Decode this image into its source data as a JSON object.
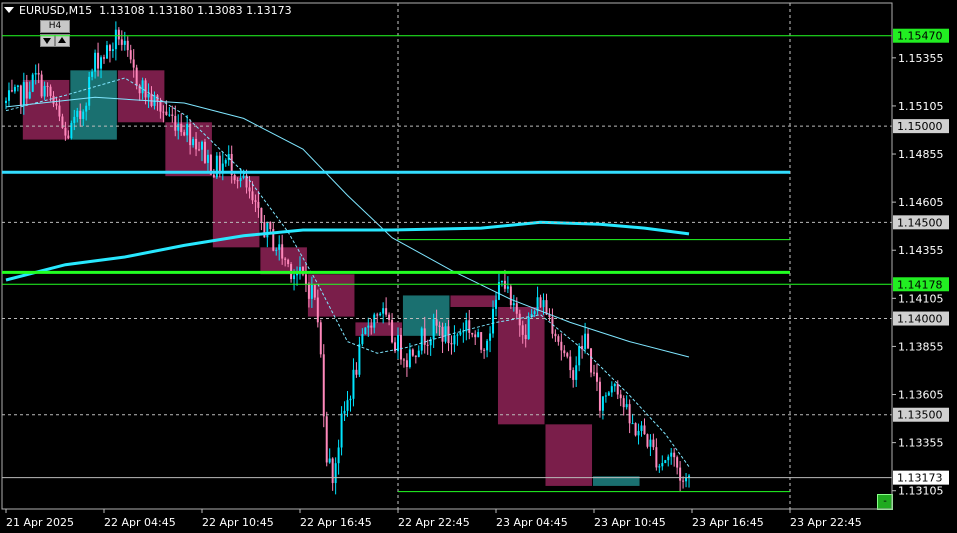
{
  "header": {
    "symbol": "EURUSD,M15",
    "ohlc": "1.13108 1.13180 1.13083 1.13173"
  },
  "timeframe_box": {
    "label": "H4"
  },
  "minus_button": {
    "label": "-"
  },
  "colors": {
    "background": "#000000",
    "bull_candle": "#00e5ff",
    "bear_candle": "#ff88bb",
    "h4_bull_box": "#1a7070",
    "h4_bear_box": "#7a1e4a",
    "ma_fast": "#7fe6ff",
    "ma_slow": "#28e8ff",
    "level_green": "#22ff22",
    "level_cyan": "#33ddff",
    "price_tag": "#d0d0d0",
    "green_tag": "#22ee22"
  },
  "chart_data": {
    "type": "candlestick",
    "symbol": "EURUSD",
    "timeframe": "M15",
    "ylim": [
      1.1301,
      1.1564
    ],
    "y_ticks": [
      1.15355,
      1.15105,
      1.14855,
      1.14605,
      1.14355,
      1.14105,
      1.13855,
      1.13605,
      1.13355,
      1.13105
    ],
    "x_ticks": [
      {
        "label": "21 Apr 2025",
        "i": 0
      },
      {
        "label": "22 Apr 04:45",
        "i": 33
      },
      {
        "label": "22 Apr 10:45",
        "i": 66
      },
      {
        "label": "22 Apr 16:45",
        "i": 99
      },
      {
        "label": "22 Apr 22:45",
        "i": 132
      },
      {
        "label": "23 Apr 04:45",
        "i": 165
      },
      {
        "label": "23 Apr 10:45",
        "i": 198
      },
      {
        "label": "23 Apr 16:45",
        "i": 231
      },
      {
        "label": "23 Apr 22:45",
        "i": 264
      }
    ],
    "vertical_dashed_at": [
      132,
      264
    ],
    "levels": [
      {
        "price": 1.1547,
        "color": "green",
        "style": "thin",
        "tag": "1.15470",
        "tag_style": "green"
      },
      {
        "price": 1.15,
        "color": "gray",
        "style": "dashed",
        "tag": "1.15000",
        "tag_style": "gray"
      },
      {
        "price": 1.1476,
        "color": "cyan",
        "style": "thick",
        "tag": "",
        "tag_style": ""
      },
      {
        "price": 1.145,
        "color": "gray",
        "style": "dashed",
        "tag": "1.14500",
        "tag_style": "gray"
      },
      {
        "price": 1.1441,
        "color": "green",
        "style": "thin_partial",
        "tag": "",
        "tag_style": ""
      },
      {
        "price": 1.1424,
        "color": "green",
        "style": "thick",
        "tag": "",
        "tag_style": ""
      },
      {
        "price": 1.14178,
        "color": "green",
        "style": "thin",
        "tag": "1.14178",
        "tag_style": "green"
      },
      {
        "price": 1.14,
        "color": "gray",
        "style": "dashed",
        "tag": "1.14000",
        "tag_style": "gray"
      },
      {
        "price": 1.135,
        "color": "gray",
        "style": "dashed",
        "tag": "1.13500",
        "tag_style": "gray"
      },
      {
        "price": 1.13173,
        "color": "gray",
        "style": "thin",
        "tag": "1.13173",
        "tag_style": "white"
      },
      {
        "price": 1.131,
        "color": "green",
        "style": "thin_partial",
        "tag": "",
        "tag_style": ""
      }
    ],
    "h4_boxes": [
      {
        "start": 6,
        "end": 21,
        "open": 1.1524,
        "close": 1.1493,
        "bull": false
      },
      {
        "start": 22,
        "end": 37,
        "open": 1.1493,
        "close": 1.1529,
        "bull": true
      },
      {
        "start": 38,
        "end": 53,
        "open": 1.1529,
        "close": 1.1502,
        "bull": false
      },
      {
        "start": 54,
        "end": 69,
        "open": 1.1502,
        "close": 1.1474,
        "bull": false
      },
      {
        "start": 70,
        "end": 85,
        "open": 1.1474,
        "close": 1.1437,
        "bull": false
      },
      {
        "start": 86,
        "end": 101,
        "open": 1.1437,
        "close": 1.1423,
        "bull": false
      },
      {
        "start": 102,
        "end": 117,
        "open": 1.1423,
        "close": 1.1401,
        "bull": false
      },
      {
        "start": 118,
        "end": 133,
        "open": 1.1398,
        "close": 1.1391,
        "bull": false
      },
      {
        "start": 134,
        "end": 149,
        "open": 1.1391,
        "close": 1.1412,
        "bull": true
      },
      {
        "start": 150,
        "end": 165,
        "open": 1.1412,
        "close": 1.1406,
        "bull": false
      },
      {
        "start": 166,
        "end": 181,
        "open": 1.1406,
        "close": 1.1345,
        "bull": false
      },
      {
        "start": 182,
        "end": 197,
        "open": 1.1345,
        "close": 1.1313,
        "bull": false
      },
      {
        "start": 198,
        "end": 213,
        "open": 1.1313,
        "close": 1.1318,
        "bull": true
      }
    ],
    "path_anchors": [
      [
        0,
        1.1512
      ],
      [
        5,
        1.1516
      ],
      [
        10,
        1.1525
      ],
      [
        15,
        1.1515
      ],
      [
        20,
        1.1494
      ],
      [
        25,
        1.1505
      ],
      [
        30,
        1.1534
      ],
      [
        35,
        1.154
      ],
      [
        38,
        1.1548
      ],
      [
        42,
        1.153
      ],
      [
        48,
        1.1515
      ],
      [
        55,
        1.1505
      ],
      [
        60,
        1.15
      ],
      [
        65,
        1.149
      ],
      [
        70,
        1.1478
      ],
      [
        75,
        1.1482
      ],
      [
        80,
        1.147
      ],
      [
        85,
        1.1452
      ],
      [
        90,
        1.144
      ],
      [
        95,
        1.1428
      ],
      [
        100,
        1.142
      ],
      [
        104,
        1.1412
      ],
      [
        106,
        1.138
      ],
      [
        108,
        1.133
      ],
      [
        110,
        1.1318
      ],
      [
        113,
        1.1345
      ],
      [
        118,
        1.1375
      ],
      [
        122,
        1.1398
      ],
      [
        126,
        1.1405
      ],
      [
        130,
        1.139
      ],
      [
        135,
        1.138
      ],
      [
        140,
        1.139
      ],
      [
        145,
        1.1395
      ],
      [
        150,
        1.1388
      ],
      [
        155,
        1.1398
      ],
      [
        160,
        1.1385
      ],
      [
        164,
        1.14
      ],
      [
        167,
        1.1425
      ],
      [
        170,
        1.1405
      ],
      [
        175,
        1.1395
      ],
      [
        180,
        1.141
      ],
      [
        185,
        1.1395
      ],
      [
        190,
        1.137
      ],
      [
        195,
        1.139
      ],
      [
        200,
        1.1355
      ],
      [
        205,
        1.137
      ],
      [
        210,
        1.1345
      ],
      [
        215,
        1.134
      ],
      [
        220,
        1.1325
      ],
      [
        224,
        1.133
      ],
      [
        228,
        1.1315
      ],
      [
        230,
        1.1317
      ]
    ],
    "ma_fast": [
      [
        0,
        1.1508
      ],
      [
        20,
        1.1516
      ],
      [
        40,
        1.1525
      ],
      [
        60,
        1.1506
      ],
      [
        80,
        1.1476
      ],
      [
        95,
        1.1445
      ],
      [
        105,
        1.1418
      ],
      [
        115,
        1.1388
      ],
      [
        125,
        1.1382
      ],
      [
        135,
        1.1385
      ],
      [
        150,
        1.1392
      ],
      [
        165,
        1.1398
      ],
      [
        180,
        1.1402
      ],
      [
        195,
        1.1383
      ],
      [
        210,
        1.136
      ],
      [
        222,
        1.134
      ],
      [
        230,
        1.1323
      ]
    ],
    "ma_mid": [
      [
        0,
        1.151
      ],
      [
        30,
        1.1515
      ],
      [
        60,
        1.1512
      ],
      [
        80,
        1.1504
      ],
      [
        100,
        1.1488
      ],
      [
        115,
        1.1464
      ],
      [
        130,
        1.1442
      ],
      [
        150,
        1.1425
      ],
      [
        170,
        1.141
      ],
      [
        190,
        1.1398
      ],
      [
        210,
        1.1388
      ],
      [
        230,
        1.138
      ]
    ],
    "ma_slow": [
      [
        0,
        1.142
      ],
      [
        20,
        1.1428
      ],
      [
        40,
        1.1432
      ],
      [
        60,
        1.1438
      ],
      [
        80,
        1.1443
      ],
      [
        100,
        1.1446
      ],
      [
        130,
        1.1446
      ],
      [
        160,
        1.1447
      ],
      [
        180,
        1.145
      ],
      [
        200,
        1.1449
      ],
      [
        215,
        1.1447
      ],
      [
        230,
        1.1444
      ]
    ]
  }
}
